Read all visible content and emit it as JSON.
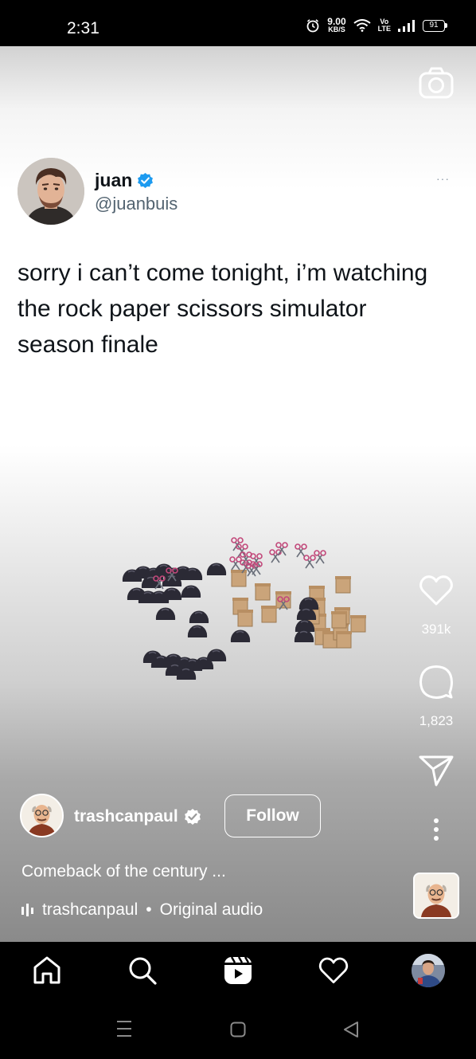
{
  "status_bar": {
    "time": "2:31",
    "net_speed_value": "9.00",
    "net_speed_unit": "KB/S",
    "volte_top": "Vo",
    "volte_bottom": "LTE",
    "battery": "91"
  },
  "tweet": {
    "display_name": "juan",
    "handle": "@juanbuis",
    "more_glyph": "···",
    "text": "sorry i can’t come tonight, i’m watching the rock paper scissors simulator season finale"
  },
  "actions": {
    "likes": "391k",
    "comments": "1,823"
  },
  "author": {
    "username": "trashcanpaul",
    "follow_label": "Follow",
    "caption": "Comeback of the century ...",
    "audio_creator": "trashcanpaul",
    "audio_separator": "•",
    "audio_label": "Original audio"
  },
  "icons": {
    "camera": "camera-icon",
    "verified": "verified-badge-icon",
    "like": "heart-icon",
    "comment": "comment-bubble-icon",
    "share": "paper-plane-icon",
    "more": "vertical-dots-icon",
    "home": "home-icon",
    "search": "search-icon",
    "reels": "reels-icon",
    "activity": "heart-outline-icon"
  },
  "colors": {
    "verified_blue": "#1d9bf0",
    "tweet_text": "#0f1419",
    "tweet_handle": "#536471"
  }
}
